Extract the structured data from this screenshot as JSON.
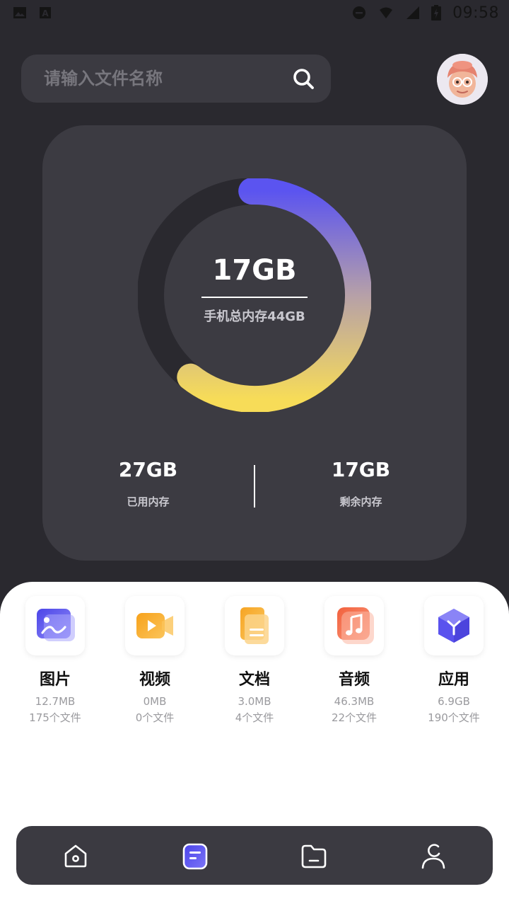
{
  "status_bar": {
    "time": "09:58",
    "icons": [
      "image-icon",
      "a-icon",
      "dnd-icon",
      "wifi-icon",
      "signal-icon",
      "battery-icon"
    ]
  },
  "search": {
    "placeholder": "请输入文件名称",
    "icon": "search-icon"
  },
  "storage": {
    "used_center": "17GB",
    "total_label": "手机总内存44GB",
    "used_value": "27GB",
    "used_label": "已用内存",
    "free_value": "17GB",
    "free_label": "剩余内存",
    "ring_fraction": 0.61,
    "gradient": [
      "#5b54f0",
      "#b6a0a8",
      "#f7dc58"
    ]
  },
  "categories": [
    {
      "name": "图片",
      "size": "12.7MB",
      "count": "175个文件",
      "icon": "image-icon"
    },
    {
      "name": "视频",
      "size": "0MB",
      "count": "0个文件",
      "icon": "video-icon"
    },
    {
      "name": "文档",
      "size": "3.0MB",
      "count": "4个文件",
      "icon": "document-icon"
    },
    {
      "name": "音频",
      "size": "46.3MB",
      "count": "22个文件",
      "icon": "music-icon"
    },
    {
      "name": "应用",
      "size": "6.9GB",
      "count": "190个文件",
      "icon": "app-cube-icon"
    }
  ],
  "bottom_nav": [
    {
      "icon": "home-icon",
      "active": false
    },
    {
      "icon": "files-list-icon",
      "active": true
    },
    {
      "icon": "folder-icon",
      "active": false
    },
    {
      "icon": "profile-icon",
      "active": false
    }
  ],
  "colors": {
    "background": "#2a292f",
    "card": "#3c3b42",
    "accent": "#5b54f0",
    "sheet": "#ffffff"
  }
}
